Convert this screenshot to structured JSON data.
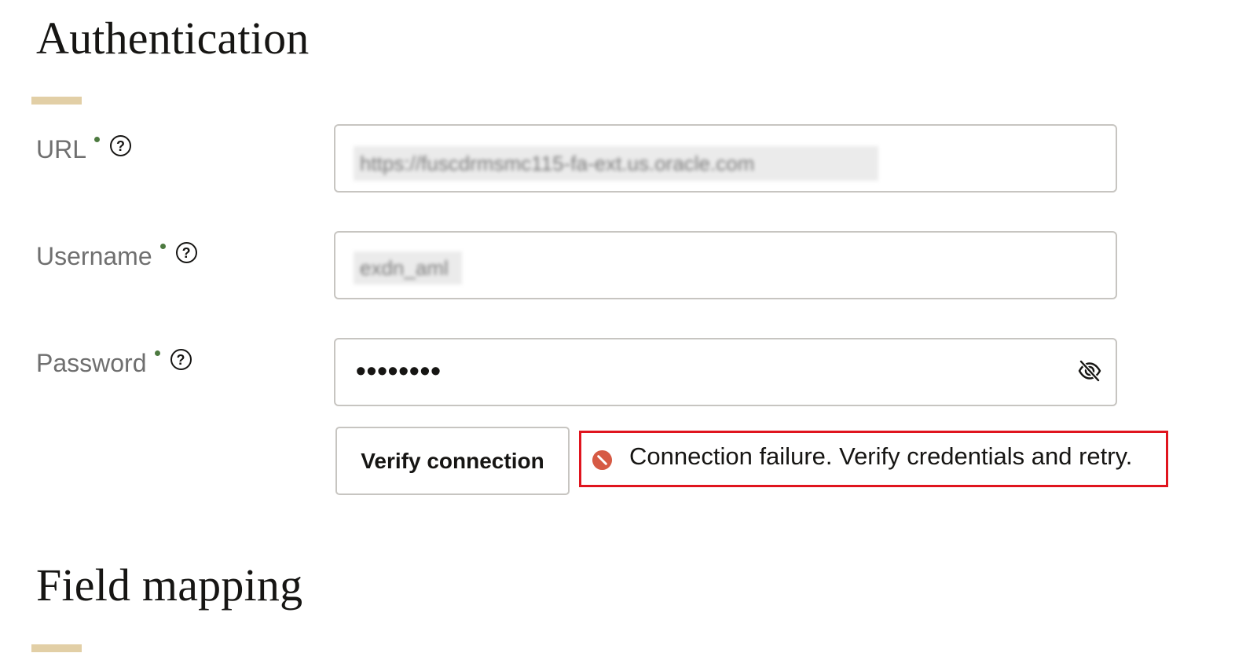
{
  "authentication": {
    "title": "Authentication",
    "url": {
      "label": "URL",
      "value": "https://fuscdrmsmc115-fa-ext.us.oracle.com",
      "help_icon": "help-circle-icon"
    },
    "username": {
      "label": "Username",
      "value": "exdn_aml",
      "help_icon": "help-circle-icon"
    },
    "password": {
      "label": "Password",
      "value": "••••••••",
      "help_icon": "help-circle-icon",
      "reveal_icon": "eye-off-icon"
    },
    "verify_button_label": "Verify connection",
    "error": {
      "icon": "error-circle-icon",
      "message": "Connection failure. Verify credentials and retry."
    }
  },
  "field_mapping": {
    "title": "Field mapping"
  },
  "colors": {
    "accent_bar": "#e2cfa6",
    "required_dot": "#4d7a40",
    "error_border": "#e0141e",
    "error_icon": "#d65a44",
    "input_border": "#c7c5c1"
  }
}
